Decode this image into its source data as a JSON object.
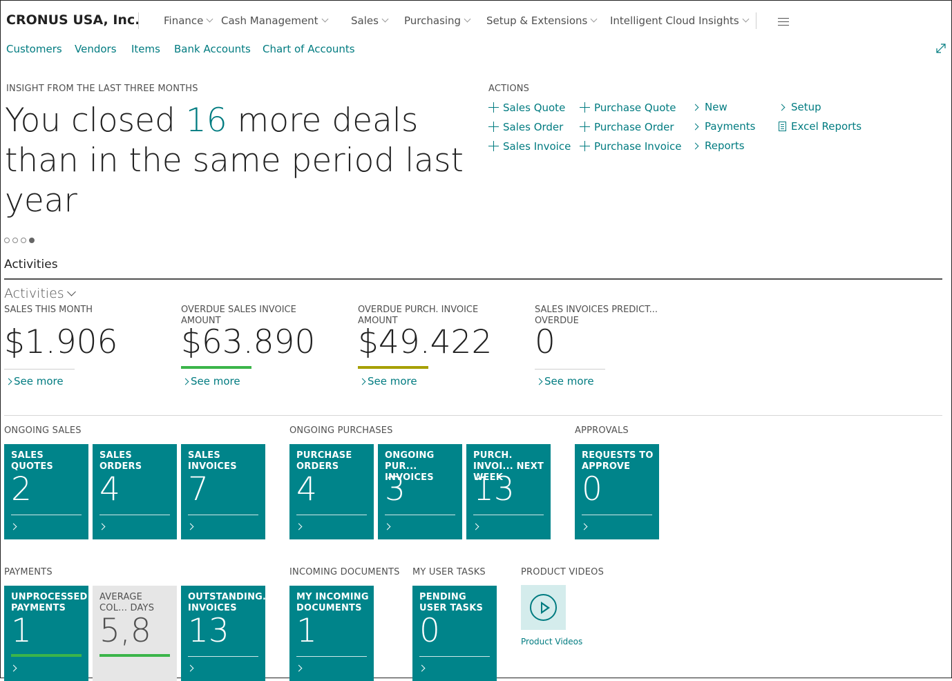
{
  "header": {
    "company": "CRONUS USA, Inc.",
    "menus": [
      "Finance",
      "Cash Management",
      "Sales",
      "Purchasing",
      "Setup & Extensions",
      "Intelligent Cloud Insights"
    ]
  },
  "subnav": [
    "Customers",
    "Vendors",
    "Items",
    "Bank Accounts",
    "Chart of Accounts"
  ],
  "insight": {
    "label": "INSIGHT FROM THE LAST THREE MONTHS",
    "pre": "You closed ",
    "num": "16",
    "post": " more deals than in the same period last year",
    "carousel_total": 4,
    "carousel_active": 4
  },
  "actions": {
    "label": "ACTIONS",
    "col1": [
      "Sales Quote",
      "Sales Order",
      "Sales Invoice"
    ],
    "col2": [
      "Purchase Quote",
      "Purchase Order",
      "Purchase Invoice"
    ],
    "col3": [
      "New",
      "Payments",
      "Reports"
    ],
    "col4": [
      "Setup",
      "Excel Reports"
    ]
  },
  "activities": {
    "section_title": "Activities",
    "group_title": "Activities",
    "see_more": "See more",
    "cues": [
      {
        "label": "SALES THIS MONTH",
        "value": "$1.906",
        "indicator": "none"
      },
      {
        "label": "OVERDUE SALES INVOICE AMOUNT",
        "value": "$63.890",
        "indicator": "#3bb54a"
      },
      {
        "label": "OVERDUE PURCH. INVOICE AMOUNT",
        "value": "$49.422",
        "indicator": "#a6a000"
      },
      {
        "label": "SALES INVOICES PREDICT... OVERDUE",
        "value": "0",
        "indicator": "none"
      }
    ]
  },
  "groups": {
    "ongoing_sales": {
      "title": "ONGOING SALES",
      "tiles": [
        {
          "label": "SALES QUOTES",
          "value": "2"
        },
        {
          "label": "SALES ORDERS",
          "value": "4"
        },
        {
          "label": "SALES INVOICES",
          "value": "7"
        }
      ]
    },
    "ongoing_purchases": {
      "title": "ONGOING PURCHASES",
      "tiles": [
        {
          "label": "PURCHASE ORDERS",
          "value": "4"
        },
        {
          "label": "ONGOING PUR... INVOICES",
          "value": "3"
        },
        {
          "label": "PURCH. INVOI... NEXT WEEK",
          "value": "13"
        }
      ]
    },
    "approvals": {
      "title": "APPROVALS",
      "tiles": [
        {
          "label": "REQUESTS TO APPROVE",
          "value": "0"
        }
      ]
    },
    "payments": {
      "title": "PAYMENTS",
      "tiles": [
        {
          "label": "UNPROCESSED PAYMENTS",
          "value": "1",
          "indicator": "#3bb54a"
        },
        {
          "label": "AVERAGE COL... DAYS",
          "value": "5,8",
          "indicator": "#3bb54a"
        },
        {
          "label": "OUTSTANDING... INVOICES",
          "value": "13"
        }
      ]
    },
    "incoming_documents": {
      "title": "INCOMING DOCUMENTS",
      "tiles": [
        {
          "label": "MY INCOMING DOCUMENTS",
          "value": "1"
        }
      ]
    },
    "user_tasks": {
      "title": "MY USER TASKS",
      "tiles": [
        {
          "label": "PENDING USER TASKS",
          "value": "0"
        }
      ]
    },
    "product_videos": {
      "title": "PRODUCT VIDEOS",
      "link": "Product Videos"
    }
  }
}
